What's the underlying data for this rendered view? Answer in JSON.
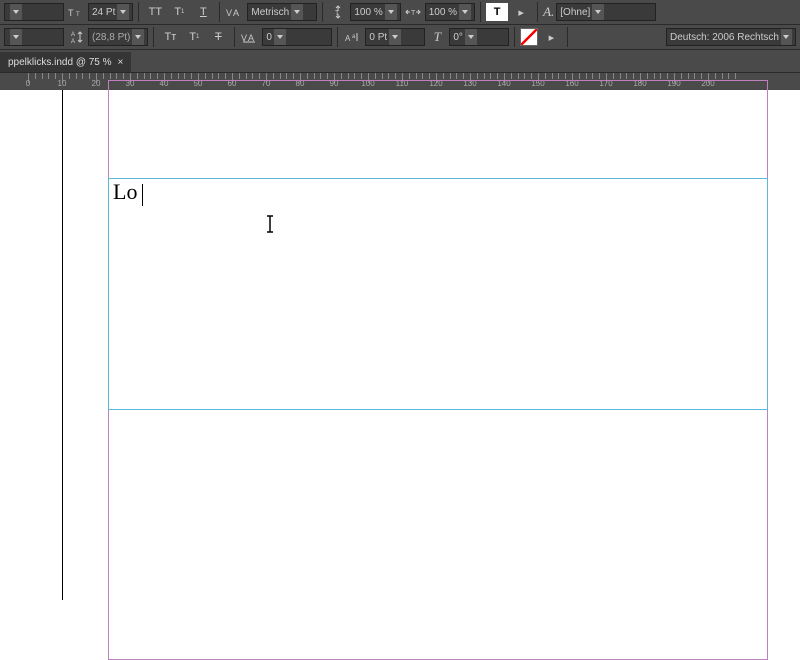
{
  "toolbar": {
    "row1": {
      "fontSize": "24 Pt",
      "kerning": "Metrisch",
      "vscale": "100 %",
      "hscale": "100 %",
      "charStyle": "[Ohne]"
    },
    "row2": {
      "leading": "(28,8 Pt)",
      "tracking": "0",
      "baseline": "0 Pt",
      "skew": "0°",
      "language": "Deutsch: 2006 Rechtsch..."
    }
  },
  "tab": {
    "title": "ppelklicks.indd @ 75 %"
  },
  "ruler": {
    "marks": [
      0,
      10,
      20,
      30,
      40,
      50,
      60,
      70,
      80,
      90,
      100,
      110,
      120,
      130,
      140,
      150,
      160,
      170,
      180,
      190,
      200
    ]
  },
  "document": {
    "text": "Lo"
  }
}
